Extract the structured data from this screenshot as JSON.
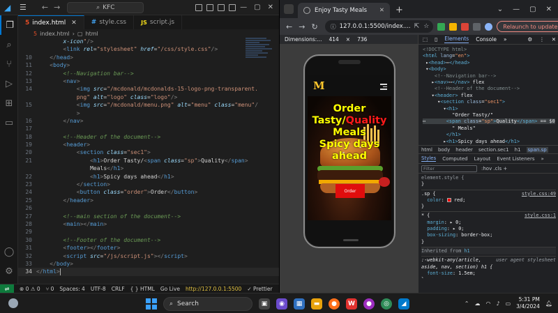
{
  "vscode": {
    "menu_icon": "hamburger-icon",
    "search_text": "KFC",
    "tabs": [
      {
        "label": "index.html",
        "badge": "5"
      },
      {
        "label": "style.css",
        "badge": "css"
      },
      {
        "label": "script.js",
        "badge": "JS"
      }
    ],
    "breadcrumb": [
      "index.html",
      "html"
    ],
    "lines": [
      {
        "n": "",
        "html": "        <span class='c-attr'>x-icon</span><span class='c-str'>\"</span><span class='c-brk'>/&gt;</span>"
      },
      {
        "n": "",
        "html": "        <span class='c-brk'>&lt;</span><span class='c-tag'>link</span> <span class='c-attr'>rel</span>=<span class='c-str'>\"stylesheet\"</span> <span class='c-attr'>href</span>=<span class='c-str'>\"/css/style.css\"</span><span class='c-brk'>/&gt;</span>"
      },
      {
        "n": "10",
        "html": "    <span class='c-brk'>&lt;/</span><span class='c-tag'>head</span><span class='c-brk'>&gt;</span>"
      },
      {
        "n": "11",
        "html": "    <span class='c-brk'>&lt;</span><span class='c-tag'>body</span><span class='c-brk'>&gt;</span>"
      },
      {
        "n": "12",
        "html": "        <span class='c-com'>&lt;!--Navigation bar--&gt;</span>"
      },
      {
        "n": "13",
        "html": "        <span class='c-brk'>&lt;</span><span class='c-tag'>nav</span><span class='c-brk'>&gt;</span>"
      },
      {
        "n": "14",
        "html": "            <span class='c-brk'>&lt;</span><span class='c-tag'>img</span> <span class='c-attr'>src</span>=<span class='c-str'>\"/mcdonald/mcdonalds-15-logo-png-transparent.</span>"
      },
      {
        "n": "",
        "html": "            <span class='c-str'>png\"</span> <span class='c-attr'>alt</span>=<span class='c-str'>\"logo\"</span> <span class='c-attr'>class</span>=<span class='c-str'>\"logo\"</span><span class='c-brk'>/&gt;</span>"
      },
      {
        "n": "15",
        "html": "            <span class='c-brk'>&lt;</span><span class='c-tag'>img</span> <span class='c-attr'>src</span>=<span class='c-str'>\"/mcdonald/menu.png\"</span> <span class='c-attr'>alt</span>=<span class='c-str'>\"menu\"</span> <span class='c-attr'>class</span>=<span class='c-str'>\"menu\"</span><span class='c-brk'>/</span>"
      },
      {
        "n": "",
        "html": "            <span class='c-brk'>&gt;</span>"
      },
      {
        "n": "16",
        "html": "        <span class='c-brk'>&lt;/</span><span class='c-tag'>nav</span><span class='c-brk'>&gt;</span>"
      },
      {
        "n": "17",
        "html": ""
      },
      {
        "n": "18",
        "html": "        <span class='c-com'>&lt;!--Header of the document--&gt;</span>"
      },
      {
        "n": "19",
        "html": "        <span class='c-brk'>&lt;</span><span class='c-tag'>header</span><span class='c-brk'>&gt;</span>"
      },
      {
        "n": "20",
        "html": "            <span class='c-brk'>&lt;</span><span class='c-tag'>section</span> <span class='c-attr'>class</span>=<span class='c-str'>\"sec1\"</span><span class='c-brk'>&gt;</span>"
      },
      {
        "n": "21",
        "html": "                <span class='c-brk'>&lt;</span><span class='c-tag'>h1</span><span class='c-brk'>&gt;</span><span class='c-txt'>Order Tasty/</span><span class='c-brk'>&lt;</span><span class='c-tag'>span</span> <span class='c-attr'>class</span>=<span class='c-str'>\"sp\"</span><span class='c-brk'>&gt;</span><span class='c-txt'>Quality</span><span class='c-brk'>&lt;/</span><span class='c-tag'>span</span><span class='c-brk'>&gt;</span>"
      },
      {
        "n": "",
        "html": "                <span class='c-txt'>Meals</span><span class='c-brk'>&lt;/</span><span class='c-tag'>h1</span><span class='c-brk'>&gt;</span>"
      },
      {
        "n": "22",
        "html": "                <span class='c-brk'>&lt;</span><span class='c-tag'>h1</span><span class='c-brk'>&gt;</span><span class='c-txt'>Spicy days ahead</span><span class='c-brk'>&lt;/</span><span class='c-tag'>h1</span><span class='c-brk'>&gt;</span>"
      },
      {
        "n": "23",
        "html": "            <span class='c-brk'>&lt;/</span><span class='c-tag'>section</span><span class='c-brk'>&gt;</span>"
      },
      {
        "n": "24",
        "html": "            <span class='c-brk'>&lt;</span><span class='c-tag'>button</span> <span class='c-attr'>class</span>=<span class='c-str'>\"order\"</span><span class='c-brk'>&gt;</span><span class='c-txt'>Order</span><span class='c-brk'>&lt;/</span><span class='c-tag'>button</span><span class='c-brk'>&gt;</span>"
      },
      {
        "n": "25",
        "html": "        <span class='c-brk'>&lt;/</span><span class='c-tag'>header</span><span class='c-brk'>&gt;</span>"
      },
      {
        "n": "26",
        "html": ""
      },
      {
        "n": "27",
        "html": "        <span class='c-com'>&lt;!--main section of the document--&gt;</span>"
      },
      {
        "n": "28",
        "html": "        <span class='c-brk'>&lt;</span><span class='c-tag'>main</span><span class='c-brk'>&gt;&lt;/</span><span class='c-tag'>main</span><span class='c-brk'>&gt;</span>"
      },
      {
        "n": "29",
        "html": ""
      },
      {
        "n": "30",
        "html": "        <span class='c-com'>&lt;!--Footer of the document--&gt;</span>"
      },
      {
        "n": "31",
        "html": "        <span class='c-brk'>&lt;</span><span class='c-tag'>footer</span><span class='c-brk'>&gt;&lt;/</span><span class='c-tag'>footer</span><span class='c-brk'>&gt;</span>"
      },
      {
        "n": "32",
        "html": "        <span class='c-brk'>&lt;</span><span class='c-tag'>script</span> <span class='c-attr'>src</span>=<span class='c-str'>\"/js/script.js\"</span><span class='c-brk'>&gt;&lt;/</span><span class='c-tag'>script</span><span class='c-brk'>&gt;</span>"
      },
      {
        "n": "33",
        "html": "    <span class='c-brk'>&lt;/</span><span class='c-tag'>body</span><span class='c-brk'>&gt;</span>"
      },
      {
        "n": "34",
        "html": "<span class='c-brk'>&lt;/</span><span class='c-tag'>html</span><span class='c-brk'>&gt;</span><span class='caret'></span>"
      }
    ],
    "status": {
      "errors": "⊗ 0 ⚠ 0",
      "ports": "⑂ 0",
      "spaces": "Spaces: 4",
      "encoding": "UTF-8",
      "eol": "CRLF",
      "language": "{ } HTML",
      "golive": "Go Live",
      "live_url": "http://127.0.0.1:5500",
      "prettier": "✓ Prettier"
    }
  },
  "chrome": {
    "tab_title": "Enjoy Tasty Meals",
    "url": "127.0.0.1:5500/index....",
    "relaunch": "Relaunch to update",
    "device": {
      "name": "Dimensions:...",
      "width": "414",
      "height": "736"
    },
    "site": {
      "logo": "M",
      "headline_a": "Order Tasty/",
      "headline_sp": "Quality",
      "headline_b": " Meals",
      "headline_2": "Spicy days ahead",
      "order_button": "Order"
    },
    "devtools": {
      "tabs": [
        "Elements",
        "Console"
      ],
      "crumbs": [
        "html",
        "body",
        "header",
        "section.sec1",
        "h1",
        "span.sp"
      ],
      "subtabs": [
        "Styles",
        "Computed",
        "Layout",
        "Event Listeners"
      ],
      "filter_placeholder": "Filter",
      "filter_tools": ":hov  .cls  +"
    }
  },
  "taskbar": {
    "search": "Search",
    "time": "5:31 PM",
    "date": "3/4/2024",
    "lang": "ENG IN"
  }
}
